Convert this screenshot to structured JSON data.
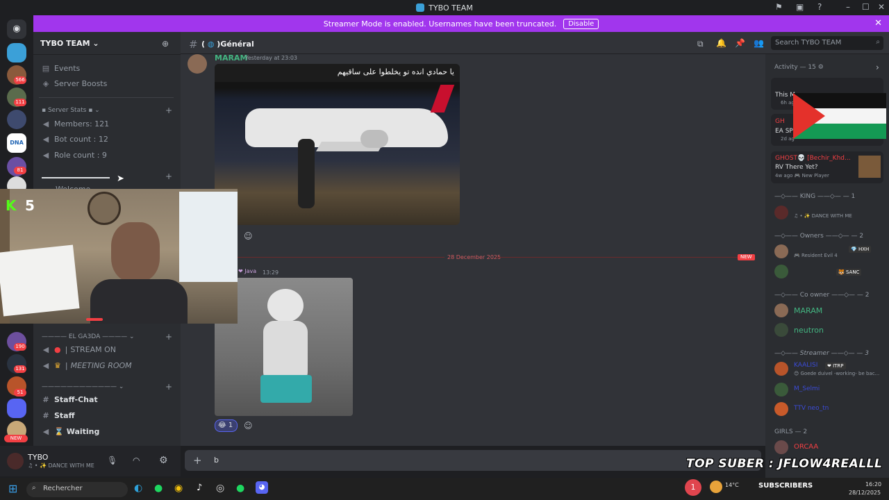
{
  "window": {
    "title": "TYBO TEAM"
  },
  "banner": {
    "text": "Streamer Mode is enabled. Usernames have been truncated.",
    "button": "Disable"
  },
  "rail": {
    "badges": [
      "566",
      "111",
      "81",
      "190",
      "131",
      "51",
      "NEW"
    ],
    "dna_label": "DNA"
  },
  "server": {
    "name": "TYBO TEAM",
    "top_items": [
      "Events",
      "Server Boosts"
    ],
    "stats_category": "Server Stats",
    "stats": [
      "Members: 121",
      "Bot count : 12",
      "Role count : 9"
    ],
    "welcome": "Welcome",
    "el_gasda_category": "EL GA3DA",
    "voice": [
      "STREAM ON",
      "MEETING ROOM"
    ],
    "staff_channels": [
      "Staff-Chat",
      "Staff",
      "Waiting"
    ]
  },
  "user": {
    "name": "TYBO",
    "status": "DANCE WITH ME"
  },
  "chat": {
    "channel": "Général",
    "msg1": {
      "author": "MARAM",
      "time": "Yesterday at 23:03",
      "text": "يا حمادي انده تو يخلطوا على ساقيهم"
    },
    "divider": {
      "date": "28 December 2025",
      "new": "NEW"
    },
    "msg2": {
      "author_tag": "Java",
      "time": "13:29",
      "reaction_count": "1"
    },
    "input_value": "b"
  },
  "search": {
    "placeholder": "Search TYBO TEAM"
  },
  "activity": {
    "header": "Activity — 15",
    "cards": [
      {
        "line1": "",
        "line2": "This M",
        "line3": "6h ag"
      },
      {
        "line1": "GH",
        "line2": "EA SPO",
        "line3": "2d ag"
      },
      {
        "line1": "GHOST💀 [Bechir_Khd...",
        "line2": "RV There Yet?",
        "line3": "4w ago",
        "extra": "New Player"
      }
    ]
  },
  "members": {
    "groups": [
      {
        "label": "—◇—— KING ——◇— — 1"
      },
      {
        "label": "—◇—— Owners ——◇— — 2"
      },
      {
        "label": "—◇—— Co owner ——◇— — 2"
      },
      {
        "label": "—◇—— Streamer ——◇— — 3"
      },
      {
        "label": "GIRLS — 2"
      }
    ],
    "king_status": "DANCE WITH ME",
    "owner1_status": "Resident Evil 4",
    "owner1_tag": "HXH",
    "owner2_tag": "SANC",
    "coowners": [
      "MARAM",
      "neutron"
    ],
    "streamer1_name": "KAALISI",
    "streamer1_tag": "ITRP",
    "streamer1_status": "Goede duivel -working- be bac...",
    "streamer2_name": "M_Selmi",
    "streamer3_name": "TTV neo_tn",
    "girl1": "ORCAA"
  },
  "overlay": {
    "webcam_counter": "5",
    "sub_text": "TOP SUBER : JFLOW4REALLL",
    "subscribers_label": "SUBSCRIBERS"
  },
  "taskbar": {
    "search": "Rechercher",
    "weather": "14°C",
    "clock_time": "16:20",
    "clock_date": "28/12/2025",
    "notif": "1"
  }
}
